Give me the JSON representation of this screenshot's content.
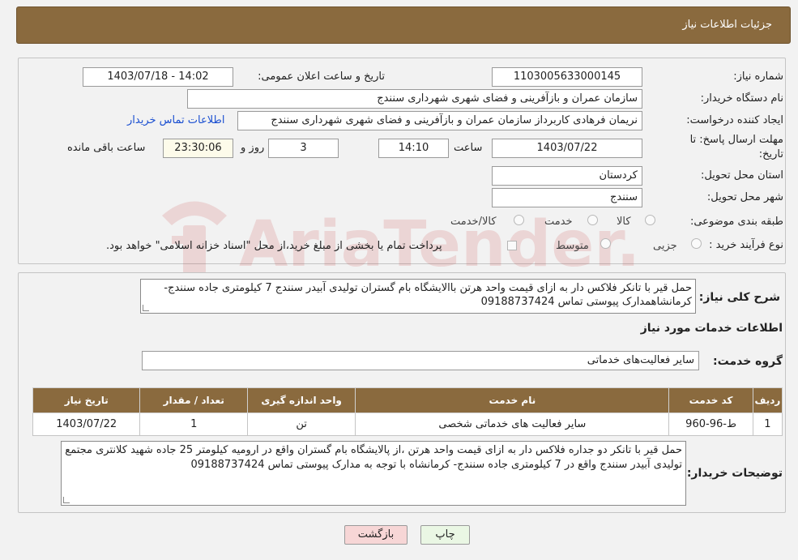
{
  "header": {
    "title": "جزئیات اطلاعات نیاز"
  },
  "form": {
    "need_number_label": "شماره نیاز:",
    "need_number": "1103005633000145",
    "announce_label": "تاریخ و ساعت اعلان عمومی:",
    "announce_value": "1403/07/18 - 14:02",
    "buyer_org_label": "نام دستگاه خریدار:",
    "buyer_org": "سازمان عمران و بازآفرینی و فضای شهری شهرداری سنندج",
    "creator_label": "ایجاد کننده درخواست:",
    "creator": "نریمان فرهادی کاربرداز سازمان عمران و بازآفرینی و فضای شهری شهرداری سنندج",
    "contact_link": "اطلاعات تماس خریدار",
    "deadline_label_1": "مهلت ارسال پاسخ: تا",
    "deadline_label_2": "تاریخ:",
    "deadline_date": "1403/07/22",
    "time_label": "ساعت",
    "deadline_time": "14:10",
    "days_value": "3",
    "days_label": "روز و",
    "remaining_time": "23:30:06",
    "remaining_label": "ساعت باقی مانده",
    "province_label": "استان محل تحویل:",
    "province": "کردستان",
    "city_label": "شهر محل تحویل:",
    "city": "سنندج",
    "category_label": "طبقه بندی موضوعی:",
    "category_options": [
      "کالا",
      "خدمت",
      "کالا/خدمت"
    ],
    "process_label": "نوع فرآیند خرید :",
    "process_options": [
      "جزیی",
      "متوسط"
    ],
    "payment_note": "پرداخت تمام یا بخشی از مبلغ خرید،از محل \"اسناد خزانه اسلامی\" خواهد بود."
  },
  "summary": {
    "label": "شرح کلی نیاز:",
    "text": "حمل قیر با تانکر فلاکس دار به ازای قیمت واحد هرتن باالایشگاه بام گستران تولیدی آبیدر سنندج 7 کیلومتری جاده سنندج- کرمانشاهمدارک پیوستی تماس 09188737424"
  },
  "services": {
    "section_title": "اطلاعات خدمات مورد نیاز",
    "group_label": "گروه خدمت:",
    "group_value": "سایر فعالیت‌های خدماتی",
    "columns": [
      "ردیف",
      "کد خدمت",
      "نام خدمت",
      "واحد اندازه گیری",
      "تعداد / مقدار",
      "تاریخ نیاز"
    ],
    "rows": [
      [
        "1",
        "ط-96-960",
        "سایر فعالیت های خدماتی شخصی",
        "تن",
        "1",
        "1403/07/22"
      ]
    ]
  },
  "buyer_notes": {
    "label": "توضیحات خریدار:",
    "text": "حمل  قیر با تانکر دو جداره فلاکس دار به ازای قیمت واحد هرتن ،از پالایشگاه بام گستران واقع در ارومیه کیلومتر 25 جاده شهید کلانتری  مجتمع تولیدی آبیدر سنندج واقع در 7 کیلومتری جاده سنندج- کرمانشاه با توجه به مدارک پیوستی تماس 09188737424"
  },
  "buttons": {
    "print": "چاپ",
    "back": "بازگشت"
  },
  "watermark": "AriaTender.neT",
  "colors": {
    "header": "#8a6a3e",
    "link": "#1a4fd1",
    "back_button": "#f7d6d6",
    "print_button": "#eaf7e4"
  }
}
